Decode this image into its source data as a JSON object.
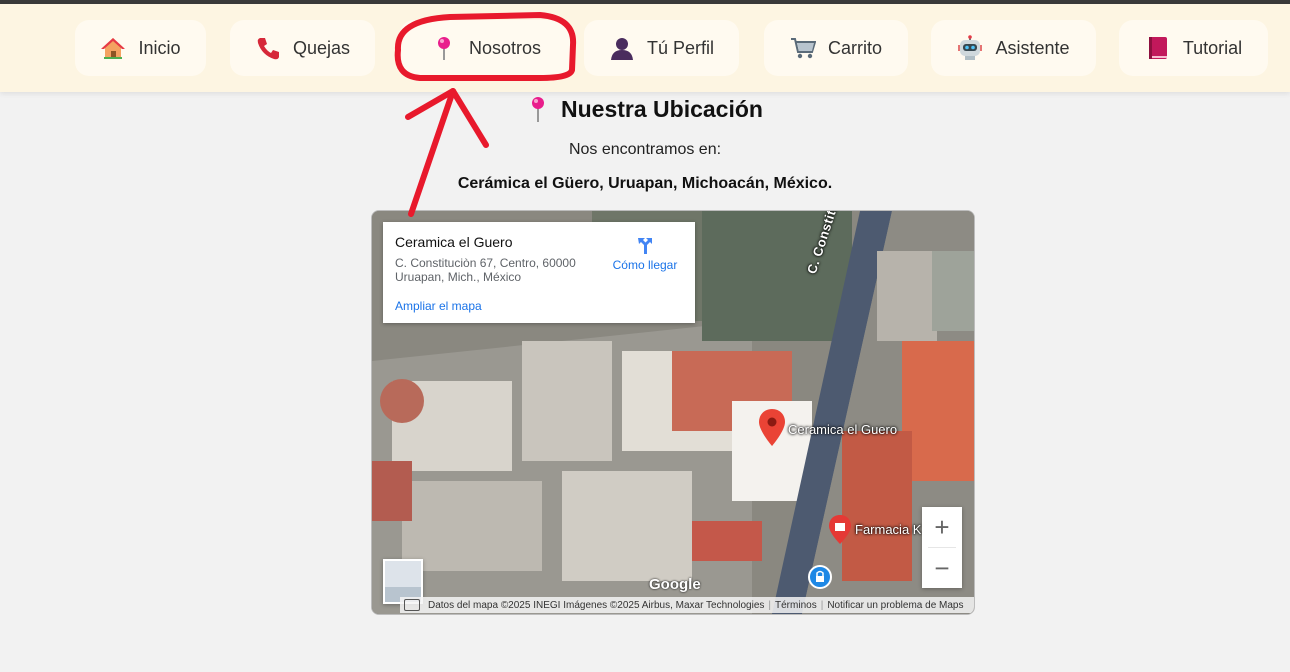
{
  "nav": {
    "items": [
      {
        "label": "Inicio",
        "icon": "house-icon"
      },
      {
        "label": "Quejas",
        "icon": "phone-icon"
      },
      {
        "label": "Nosotros",
        "icon": "pushpin-icon"
      },
      {
        "label": "Tú Perfil",
        "icon": "person-icon"
      },
      {
        "label": "Carrito",
        "icon": "cart-icon"
      },
      {
        "label": "Asistente",
        "icon": "robot-icon"
      },
      {
        "label": "Tutorial",
        "icon": "book-icon"
      }
    ]
  },
  "main": {
    "title": "Nuestra Ubicación",
    "subtitle": "Nos encontramos en:",
    "address": "Cerámica el Güero, Uruapan, Michoacán, México."
  },
  "map": {
    "card": {
      "name": "Ceramica el Guero",
      "address": "C. Constituciòn 67, Centro, 60000 Uruapan, Mich., México",
      "enlarge_link": "Ampliar el mapa",
      "directions": "Cómo llegar"
    },
    "street_label": "C. Constitución",
    "marker_label": "Ceramica el Guero",
    "pharmacy_label": "Farmacia K",
    "google_logo": "Google",
    "zoom_in": "+",
    "zoom_out": "−",
    "attribution": {
      "data": "Datos del mapa ©2025 INEGI Imágenes ©2025 Airbus, Maxar Technologies",
      "terms": "Términos",
      "report": "Notificar un problema de Maps"
    }
  },
  "colors": {
    "navbar_bg": "#fdf5e2",
    "annotation_red": "#e8192c",
    "link_blue": "#1a73e8",
    "pin_pink": "#e91e8c"
  }
}
